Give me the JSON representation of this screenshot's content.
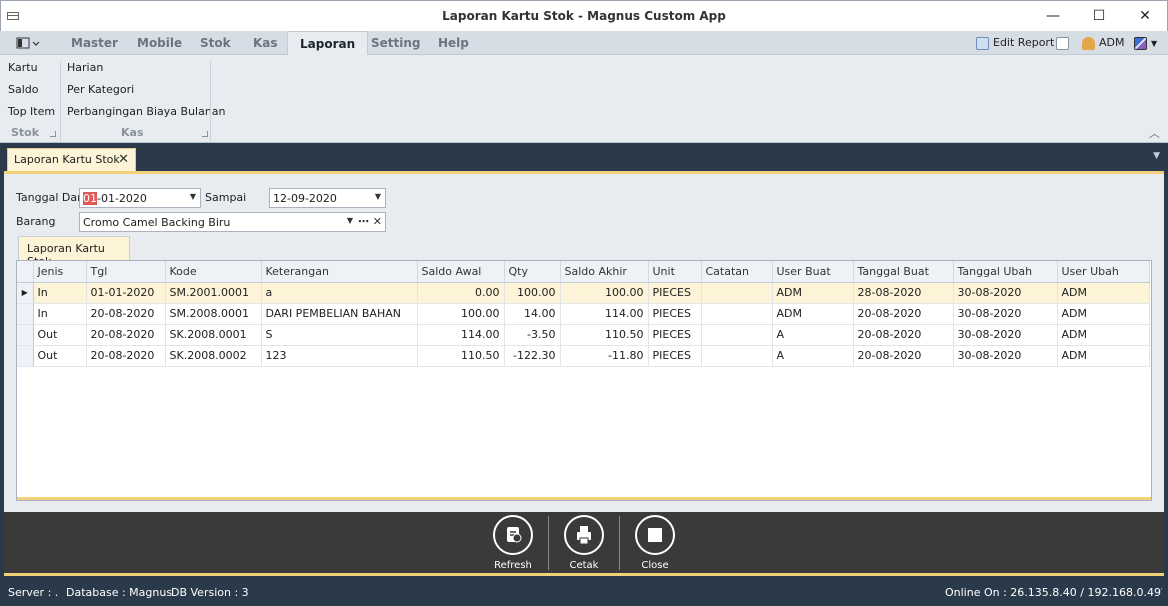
{
  "window": {
    "title": "Laporan Kartu Stok - Magnus Custom App",
    "minimize": "—",
    "maximize": "☐",
    "close": "✕"
  },
  "ribbon": {
    "tabs": [
      "Master",
      "Mobile",
      "Stok",
      "Kas",
      "Laporan",
      "Setting",
      "Help"
    ],
    "active_tab": "Laporan",
    "right": {
      "edit_report": "Edit Report",
      "user": "ADM"
    },
    "groups": {
      "stok": {
        "label": "Stok",
        "items": [
          "Kartu",
          "Saldo",
          "Top Item"
        ]
      },
      "kas": {
        "label": "Kas",
        "items": [
          "Harian",
          "Per Kategori",
          "Perbangingan Biaya Bulanan"
        ]
      }
    },
    "collapse_glyph": "︿"
  },
  "doc_tab": {
    "label": "Laporan Kartu Stok",
    "close_glyph": "✕"
  },
  "filters": {
    "tanggal_dari_label": "Tanggal Dari",
    "tanggal_dari_sel": "01",
    "tanggal_dari_rest": "-01-2020",
    "sampai_label": "Sampai",
    "sampai_value": "12-09-2020",
    "barang_label": "Barang",
    "barang_value": "Cromo Camel Backing Biru"
  },
  "inner_tab": "Laporan Kartu Stok",
  "grid": {
    "columns": [
      "Jenis",
      "Tgl",
      "Kode",
      "Keterangan",
      "Saldo Awal",
      "Qty",
      "Saldo Akhir",
      "Unit",
      "Catatan",
      "User Buat",
      "Tanggal Buat",
      "Tanggal Ubah",
      "User Ubah"
    ],
    "rows": [
      [
        "In",
        "01-01-2020",
        "SM.2001.0001",
        "a",
        "0.00",
        "100.00",
        "100.00",
        "PIECES",
        "",
        "ADM",
        "28-08-2020",
        "30-08-2020",
        "ADM"
      ],
      [
        "In",
        "20-08-2020",
        "SM.2008.0001",
        "DARI PEMBELIAN BAHAN",
        "100.00",
        "14.00",
        "114.00",
        "PIECES",
        "",
        "ADM",
        "20-08-2020",
        "30-08-2020",
        "ADM"
      ],
      [
        "Out",
        "20-08-2020",
        "SK.2008.0001",
        "S",
        "114.00",
        "-3.50",
        "110.50",
        "PIECES",
        "",
        "A",
        "20-08-2020",
        "30-08-2020",
        "ADM"
      ],
      [
        "Out",
        "20-08-2020",
        "SK.2008.0002",
        "123",
        "110.50",
        "-122.30",
        "-11.80",
        "PIECES",
        "",
        "A",
        "20-08-2020",
        "30-08-2020",
        "ADM"
      ]
    ],
    "focused_row_indicator": "▶"
  },
  "footer_buttons": {
    "refresh": "Refresh",
    "cetak": "Cetak",
    "close": "Close"
  },
  "status": {
    "server": "Server : .",
    "database": "Database : Magnus",
    "db_version": "DB Version : 3",
    "online": "Online On : 26.135.8.40 / 192.168.0.49"
  }
}
